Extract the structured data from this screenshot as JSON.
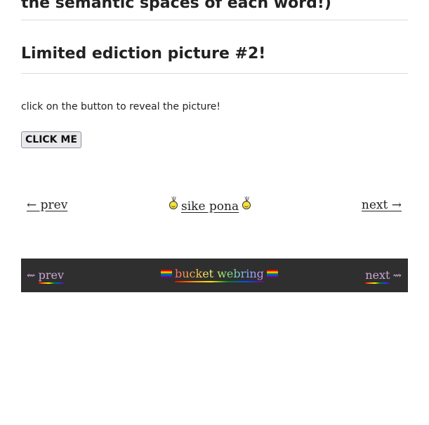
{
  "previous_heading": "the semantic spaces of each word!)",
  "section_title": "Limited ediction picture #2!",
  "instruction": "click on the button to reveal the picture!",
  "reveal_button_label": "CLICK ME",
  "webring_1": {
    "prev_label": "← prev",
    "center_label": "sike pona",
    "next_label": "next →",
    "icon": "smiley-sun-icon"
  },
  "webring_2": {
    "prev_arrow": "⇜",
    "prev_label": "prev",
    "center_label": "bucket webring",
    "next_label": "next",
    "next_arrow": "⇝",
    "icon": "pride-flag-icon",
    "background": "#2f2f2f",
    "flag_colors": [
      "#e40303",
      "#ff8c00",
      "#ffed00",
      "#008026",
      "#004dff",
      "#750787"
    ]
  }
}
